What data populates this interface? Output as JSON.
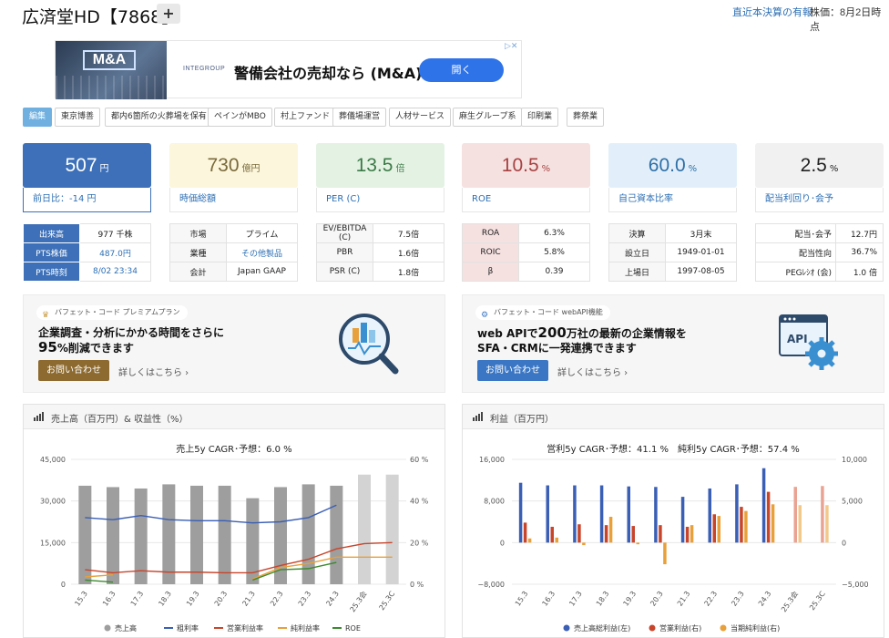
{
  "header": {
    "title": "広済堂HD【7868】",
    "plus_label": "+",
    "settlement_link": "直近本決算の有報",
    "price_note": "株価：8月2日時点"
  },
  "ad": {
    "image_label": "M&A",
    "logo_text": "INTEGROUP",
    "text": "警備会社の売却なら (M&A)",
    "button": "開く",
    "close": "▷✕"
  },
  "tags": [
    "編集",
    "東京博善",
    "都内6箇所の火葬場を保有",
    "ペインがMBO",
    "村上ファンド",
    "葬儀場運営",
    "人材サービス",
    "麻生グループ系",
    "印刷業",
    "葬祭業"
  ],
  "cards": [
    {
      "value": "507",
      "unit": "円",
      "label": "前日比：-14 円",
      "bg": "#3d70b8",
      "fg": "#ffffff"
    },
    {
      "value": "730",
      "unit": "億円",
      "label": "時価総額",
      "bg": "#fcf6dd",
      "fg": "#7a6a3a"
    },
    {
      "value": "13.5",
      "unit": "倍",
      "label": "PER (C)",
      "bg": "#e4f2e4",
      "fg": "#3c7a47"
    },
    {
      "value": "10.5",
      "unit": "%",
      "label": "ROE",
      "bg": "#f6e1e1",
      "fg": "#a64242"
    },
    {
      "value": "60.0",
      "unit": "%",
      "label": "自己資本比率",
      "bg": "#e2effa",
      "fg": "#2d6fa6"
    },
    {
      "value": "2.5",
      "unit": "%",
      "label": "配当利回り･会予",
      "bg": "#f1f1f1",
      "fg": "#222222"
    }
  ],
  "tables": [
    [
      [
        "出来高",
        "977 千株"
      ],
      [
        "PTS株価",
        "487.0円"
      ],
      [
        "PTS時刻",
        "8/02 23:34"
      ]
    ],
    [
      [
        "市場",
        "プライム"
      ],
      [
        "業種",
        "その他製品"
      ],
      [
        "会計",
        "Japan GAAP"
      ]
    ],
    [
      [
        "EV/EBITDA (C)",
        "7.5倍"
      ],
      [
        "PBR",
        "1.6倍"
      ],
      [
        "PSR (C)",
        "1.8倍"
      ]
    ],
    [
      [
        "ROA",
        "6.3%"
      ],
      [
        "ROIC",
        "5.8%"
      ],
      [
        "β",
        "0.39"
      ]
    ],
    [
      [
        "決算",
        "3月末"
      ],
      [
        "設立日",
        "1949-01-01"
      ],
      [
        "上場日",
        "1997-08-05"
      ]
    ],
    [
      [
        "配当･会予",
        "12.7円"
      ],
      [
        "配当性向",
        "36.7%"
      ],
      [
        "PEGﾚｼｵ (会)",
        "1.0 倍"
      ]
    ]
  ],
  "promo_left": {
    "pill": "バフェット・コード プレミアムプラン",
    "line1": "企業調査・分析にかかる時間をさらに",
    "line2_big": "95",
    "line2_rest": "%削減できます",
    "button": "お問い合わせ",
    "more": "詳しくはこちら ›"
  },
  "promo_right": {
    "pill": "バフェット・コード webAPI機能",
    "line1_a": "web APIで",
    "line1_big": "200",
    "line1_b": "万社の最新の企業情報を",
    "line2": "SFA・CRMに一発連携できます",
    "button": "お問い合わせ",
    "more": "詳しくはこちら ›",
    "api_label": "API"
  },
  "colors": {
    "gray_bar": "#9e9e9e",
    "forecast_bar": "#d3d3d3",
    "blue": "#3a5fb5",
    "red": "#c8452c",
    "orange": "#e8a03a",
    "green": "#3c8a2e"
  },
  "chart_data": [
    {
      "type": "bar",
      "panel_title": "売上高（百万円）& 収益性（%）",
      "title": "売上5y CAGR･予想：6.0 %",
      "categories": [
        "15.3",
        "16.3",
        "17.3",
        "18.3",
        "19.3",
        "20.3",
        "21.3",
        "22.3",
        "23.3",
        "24.3",
        "25.3会",
        "25.3C"
      ],
      "y_left_ticks": [
        "45,000",
        "30,000",
        "15,000",
        "0"
      ],
      "y_right_ticks": [
        "60 %",
        "40 %",
        "20 %",
        "0 %"
      ],
      "ylim_left": [
        0,
        45000
      ],
      "ylim_right": [
        0,
        60
      ],
      "series": [
        {
          "name": "売上高",
          "type": "bar",
          "axis": "left",
          "values": [
            35500,
            35000,
            34500,
            36000,
            35500,
            35500,
            31000,
            35000,
            36000,
            35500,
            39500,
            39500
          ]
        },
        {
          "name": "粗利率",
          "type": "line",
          "axis": "left-pct",
          "values": [
            32,
            31,
            33,
            31,
            30.5,
            30.5,
            29.5,
            30,
            32,
            38,
            null,
            null
          ]
        },
        {
          "name": "営業利益率",
          "type": "line",
          "values": [
            7,
            5.5,
            6.5,
            5.8,
            5.8,
            5.5,
            5.5,
            9,
            12,
            17,
            19.5,
            20
          ]
        },
        {
          "name": "純利益率",
          "type": "line",
          "values": [
            3.5,
            4.5,
            null,
            null,
            null,
            null,
            2.5,
            8,
            10,
            13,
            13,
            13
          ]
        },
        {
          "name": "ROE",
          "type": "line",
          "values": [
            2,
            1,
            null,
            null,
            null,
            null,
            2,
            7,
            7.5,
            10.5,
            null,
            null
          ]
        }
      ],
      "legend": [
        "売上高",
        "粗利率",
        "営業利益率",
        "純利益率",
        "ROE"
      ]
    },
    {
      "type": "bar",
      "panel_title": "利益（百万円）",
      "title": "営利5y CAGR･予想：41.1 %　純利5y CAGR･予想：57.4 %",
      "categories": [
        "15.3",
        "16.3",
        "17.3",
        "18.3",
        "19.3",
        "20.3",
        "21.3",
        "22.3",
        "23.3",
        "24.3",
        "25.3会",
        "25.3C"
      ],
      "y_left_ticks": [
        "16,000",
        "8,000",
        "0",
        "−8,000"
      ],
      "y_right_ticks": [
        "10,000",
        "5,000",
        "0",
        "−5,000"
      ],
      "ylim_left": [
        -8000,
        16000
      ],
      "ylim_right": [
        -5000,
        10000
      ],
      "series": [
        {
          "name": "売上高総利益(左)",
          "values": [
            11500,
            11000,
            11000,
            11000,
            10800,
            10700,
            8800,
            10400,
            11200,
            14300,
            null,
            null
          ]
        },
        {
          "name": "営業利益(右)",
          "values": [
            2400,
            1900,
            2200,
            2100,
            2000,
            2100,
            1900,
            3400,
            4300,
            6100,
            6700,
            6800
          ]
        },
        {
          "name": "当期純利益(右)",
          "values": [
            500,
            600,
            -300,
            3100,
            -200,
            -2600,
            2100,
            3200,
            3800,
            4600,
            4500,
            4500
          ]
        }
      ],
      "legend": [
        "売上高総利益(左)",
        "営業利益(右)",
        "当期純利益(右)"
      ]
    }
  ]
}
